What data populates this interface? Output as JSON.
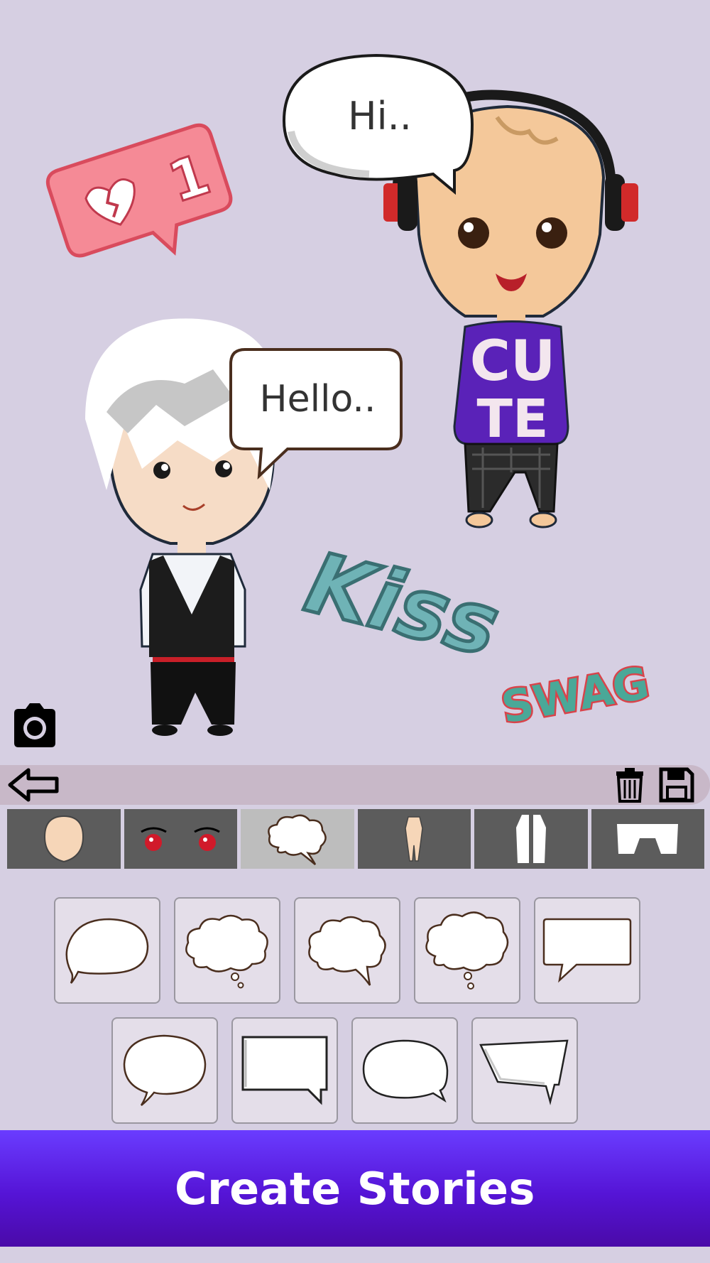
{
  "canvas": {
    "bubble_hi": "Hi..",
    "bubble_hello": "Hello..",
    "sticker_kiss": "Kiss",
    "sticker_swag": "SWAG",
    "sticker_like_count": "1",
    "shirt_text_line1": "CU",
    "shirt_text_line2": "TE"
  },
  "toolbar": {
    "back_icon": "back-arrow-icon",
    "delete_icon": "trash-icon",
    "save_icon": "floppy-disk-icon",
    "camera_icon": "camera-icon"
  },
  "tabs": [
    {
      "name": "face",
      "icon": "face-shape-icon"
    },
    {
      "name": "eyes",
      "icon": "eyes-icon"
    },
    {
      "name": "speech-bubbles",
      "icon": "speech-bubble-icon",
      "active": true
    },
    {
      "name": "body",
      "icon": "body-icon"
    },
    {
      "name": "shirt",
      "icon": "shirt-icon"
    },
    {
      "name": "pants",
      "icon": "pants-icon"
    }
  ],
  "bubble_options": [
    "oval-speech",
    "cloud-thought",
    "cloud-speech",
    "cloud-thought-2",
    "rect-speech",
    "round-speech",
    "square-speech",
    "oval-speech-2",
    "trapezoid-speech"
  ],
  "cta": {
    "label": "Create Stories"
  },
  "colors": {
    "background": "#d6cfe2",
    "cta_top": "#6a3cff",
    "cta_bottom": "#4a0aa8",
    "tab_bg": "#5c5c5c",
    "tab_active": "#bdbdbd"
  }
}
